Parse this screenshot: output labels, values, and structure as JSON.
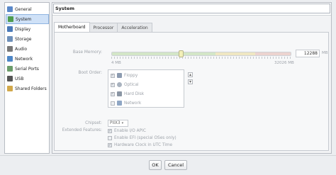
{
  "sidebar": {
    "items": [
      {
        "label": "General",
        "icon": "general-icon",
        "color": "#5a88c9"
      },
      {
        "label": "System",
        "icon": "system-icon",
        "color": "#4f9d4f",
        "active": true
      },
      {
        "label": "Display",
        "icon": "display-icon",
        "color": "#4a79b8"
      },
      {
        "label": "Storage",
        "icon": "storage-icon",
        "color": "#6d8fb9"
      },
      {
        "label": "Audio",
        "icon": "audio-icon",
        "color": "#777"
      },
      {
        "label": "Network",
        "icon": "network-icon",
        "color": "#4d86c6"
      },
      {
        "label": "Serial Ports",
        "icon": "serial-ports-icon",
        "color": "#6a9c6a"
      },
      {
        "label": "USB",
        "icon": "usb-icon",
        "color": "#555"
      },
      {
        "label": "Shared Folders",
        "icon": "shared-folders-icon",
        "color": "#d1a84a"
      }
    ]
  },
  "header": {
    "title": "System"
  },
  "tabs": [
    {
      "label": "Motherboard",
      "active": true
    },
    {
      "label": "Processor"
    },
    {
      "label": "Acceleration"
    }
  ],
  "motherboard": {
    "base_memory_label": "Base Memory:",
    "memory_value": "12288",
    "memory_unit": "MB",
    "slider_min": "4 MB",
    "slider_max": "32026 MB",
    "memory_fraction": 0.384,
    "boot_order_label": "Boot Order:",
    "boot_items": [
      {
        "label": "Floppy",
        "checked": true,
        "icon": "floppy-icon",
        "color": "#8c9bb0"
      },
      {
        "label": "Optical",
        "checked": true,
        "icon": "optical-icon",
        "color": "#a9b3bf"
      },
      {
        "label": "Hard Disk",
        "checked": true,
        "icon": "hard-disk-icon",
        "color": "#8b96a4"
      },
      {
        "label": "Network",
        "checked": false,
        "icon": "network-icon",
        "color": "#8fa6c4"
      }
    ],
    "chipset_label": "Chipset:",
    "chipset_value": "PIIX3",
    "extended_features_label": "Extended Features:",
    "features": [
      {
        "label": "Enable I/O APIC",
        "checked": true
      },
      {
        "label": "Enable EFI (special OSes only)",
        "checked": false
      },
      {
        "label": "Hardware Clock in UTC Time",
        "checked": true
      }
    ]
  },
  "footer": {
    "ok_label": "OK",
    "cancel_label": "Cancel"
  }
}
